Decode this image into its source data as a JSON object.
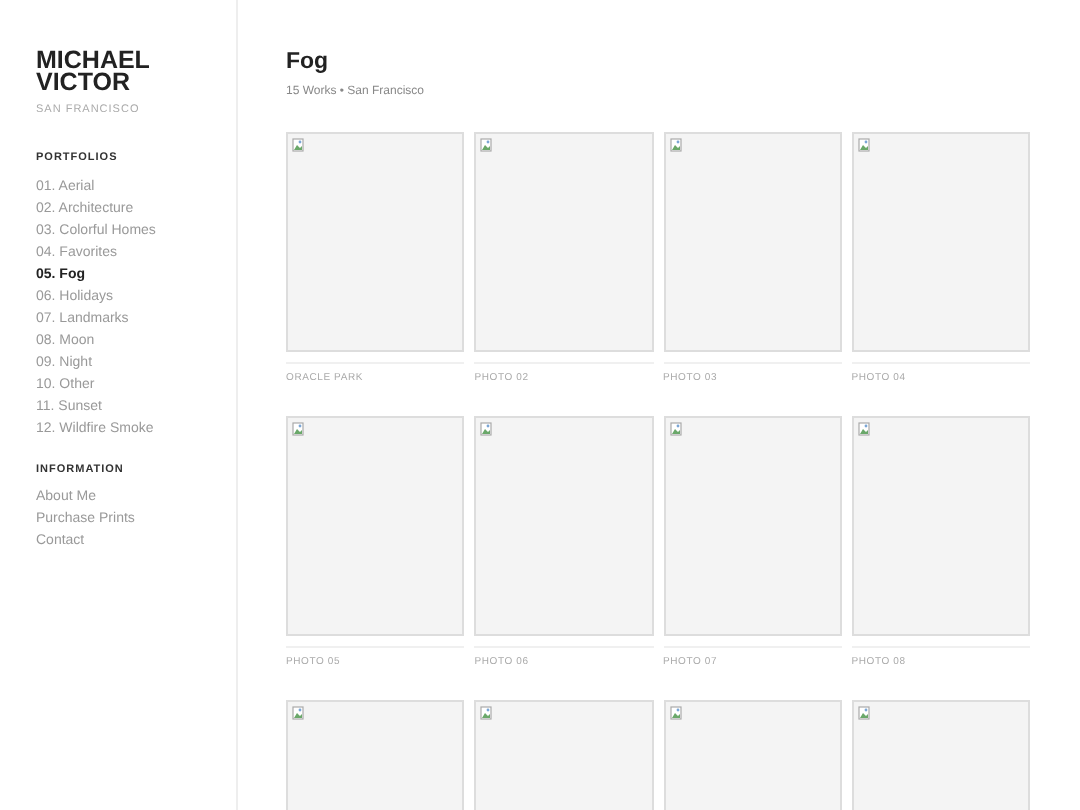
{
  "sidebar": {
    "name_lines": [
      "MICHAEL",
      "VICTOR"
    ],
    "location": "SAN FRANCISCO",
    "sections": [
      {
        "heading": "PORTFOLIOS",
        "items": [
          {
            "label": "01. Aerial",
            "selected": false
          },
          {
            "label": "02. Architecture",
            "selected": false
          },
          {
            "label": "03. Colorful Homes",
            "selected": false
          },
          {
            "label": "04. Favorites",
            "selected": false
          },
          {
            "label": "05. Fog",
            "selected": true
          },
          {
            "label": "06. Holidays",
            "selected": false
          },
          {
            "label": "07. Landmarks",
            "selected": false
          },
          {
            "label": "08. Moon",
            "selected": false
          },
          {
            "label": "09. Night",
            "selected": false
          },
          {
            "label": "10. Other",
            "selected": false
          },
          {
            "label": "11. Sunset",
            "selected": false
          },
          {
            "label": "12. Wildfire Smoke",
            "selected": false
          }
        ]
      },
      {
        "heading": "INFORMATION",
        "items": [
          {
            "label": "About Me",
            "selected": false
          },
          {
            "label": "Purchase Prints",
            "selected": false
          },
          {
            "label": "Contact",
            "selected": false
          }
        ]
      }
    ]
  },
  "gallery": {
    "title": "Fog",
    "subtitle": "15 Works • San Francisco",
    "photos": [
      {
        "kind": "picture",
        "caption": "ORACLE PARK"
      },
      {
        "kind": "picture",
        "caption": "PHOTO 02"
      },
      {
        "kind": "picture",
        "caption": "PHOTO 03"
      },
      {
        "kind": "picture",
        "caption": "PHOTO 04"
      },
      {
        "kind": "picture",
        "caption": "PHOTO 05"
      },
      {
        "kind": "picture",
        "caption": "PHOTO 06"
      },
      {
        "kind": "picture",
        "caption": "PHOTO 07"
      },
      {
        "kind": "picture",
        "caption": "PHOTO 08"
      },
      {
        "kind": "picture"
      },
      {
        "kind": "picture"
      },
      {
        "kind": "picture"
      },
      {
        "kind": "picture"
      }
    ]
  }
}
